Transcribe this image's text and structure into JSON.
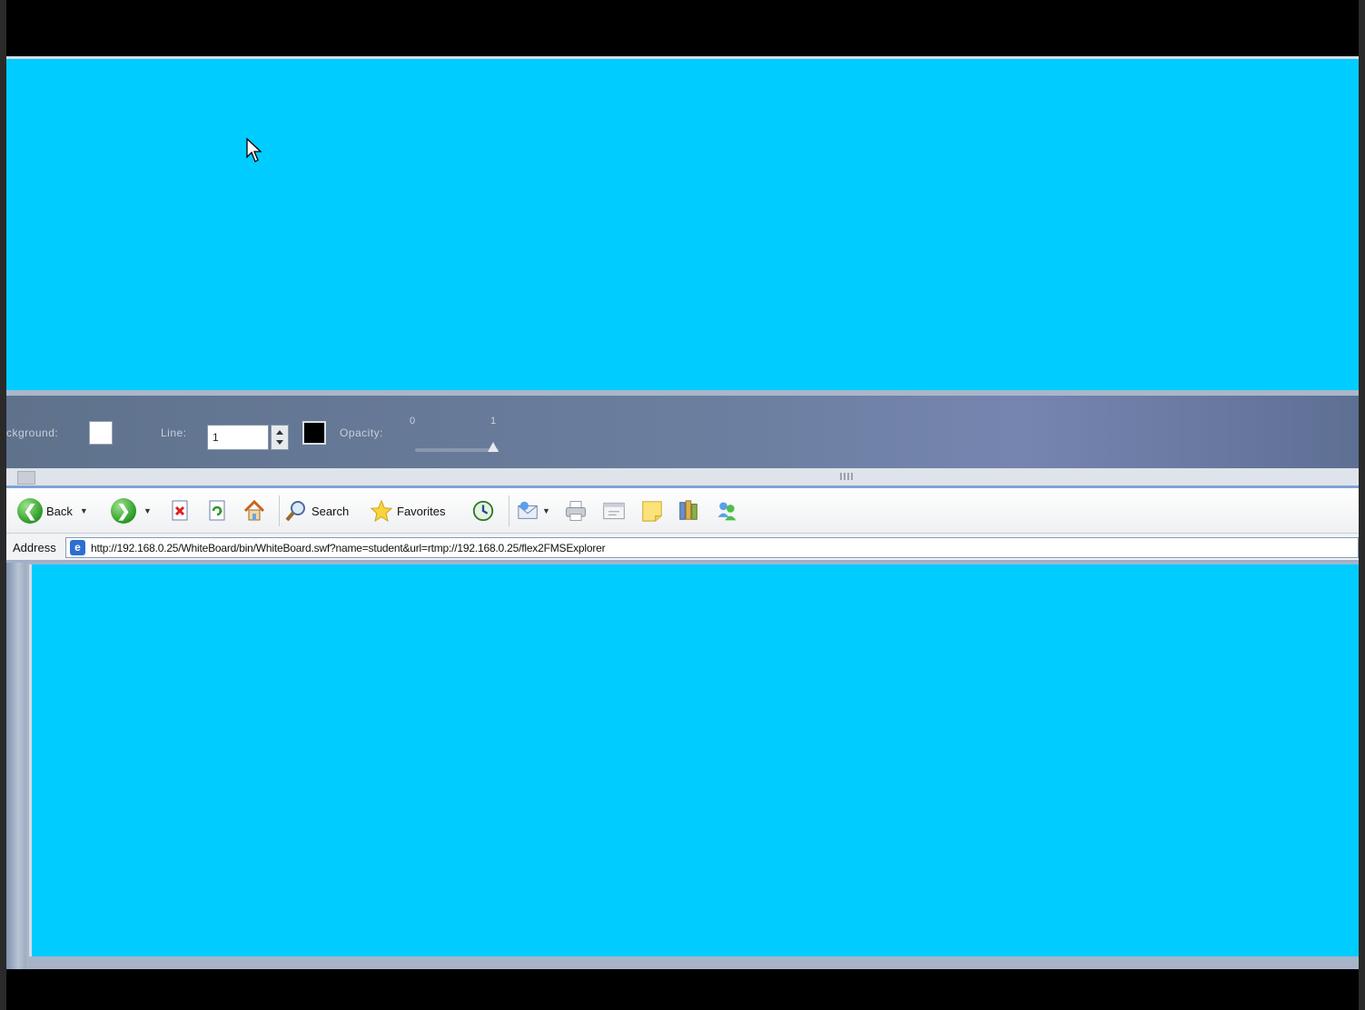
{
  "toolpanel": {
    "background_label": "ckground:",
    "line_label": "Line:",
    "line_value": "1",
    "opacity_label": "Opacity:",
    "opacity_min": "0",
    "opacity_max": "1",
    "opacity_level": 1.0,
    "background_color": "#ffffff",
    "stroke_color": "#000000"
  },
  "toolbar": {
    "back_label": "Back",
    "search_label": "Search",
    "favorites_label": "Favorites"
  },
  "address": {
    "label": "Address",
    "url": "http://192.168.0.25/WhiteBoard/bin/WhiteBoard.swf?name=student&url=rtmp://192.168.0.25/flex2FMSExplorer"
  },
  "colors": {
    "canvas": "#00ccff",
    "panel": "#66799a"
  }
}
